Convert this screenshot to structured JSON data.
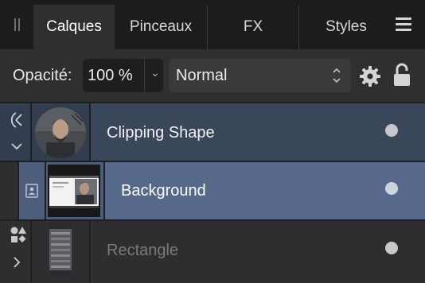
{
  "tabs": [
    {
      "label": "Calques",
      "active": true
    },
    {
      "label": "Pinceaux",
      "active": false
    },
    {
      "label": "FX",
      "active": false
    },
    {
      "label": "Styles",
      "active": false
    }
  ],
  "controls": {
    "opacity_label": "Opacité:",
    "opacity_value": "100 %",
    "blend_mode": "Normal"
  },
  "layers": [
    {
      "name": "Clipping Shape",
      "visible": true,
      "selected": false
    },
    {
      "name": "Background",
      "visible": true,
      "selected": true
    },
    {
      "name": "Rectangle",
      "visible": true,
      "selected": false,
      "dimmed": true
    }
  ],
  "colors": {
    "panel_bg": "#2b2b2d",
    "tabbar_bg": "#1c1c1e",
    "row_parent_bg": "#3a4659",
    "row_selected_bg": "#56698a",
    "row_dim_bg": "#2e2e30",
    "dim_text": "#7a7a7c"
  },
  "icons": {
    "grip": "panel-grip-icon",
    "menu": "hamburger-menu-icon",
    "gear": "gear-icon",
    "lock": "lock-open-icon",
    "clip": "clip-mask-icon",
    "pixel": "pixel-layer-icon",
    "shapes": "shapes-icon"
  }
}
